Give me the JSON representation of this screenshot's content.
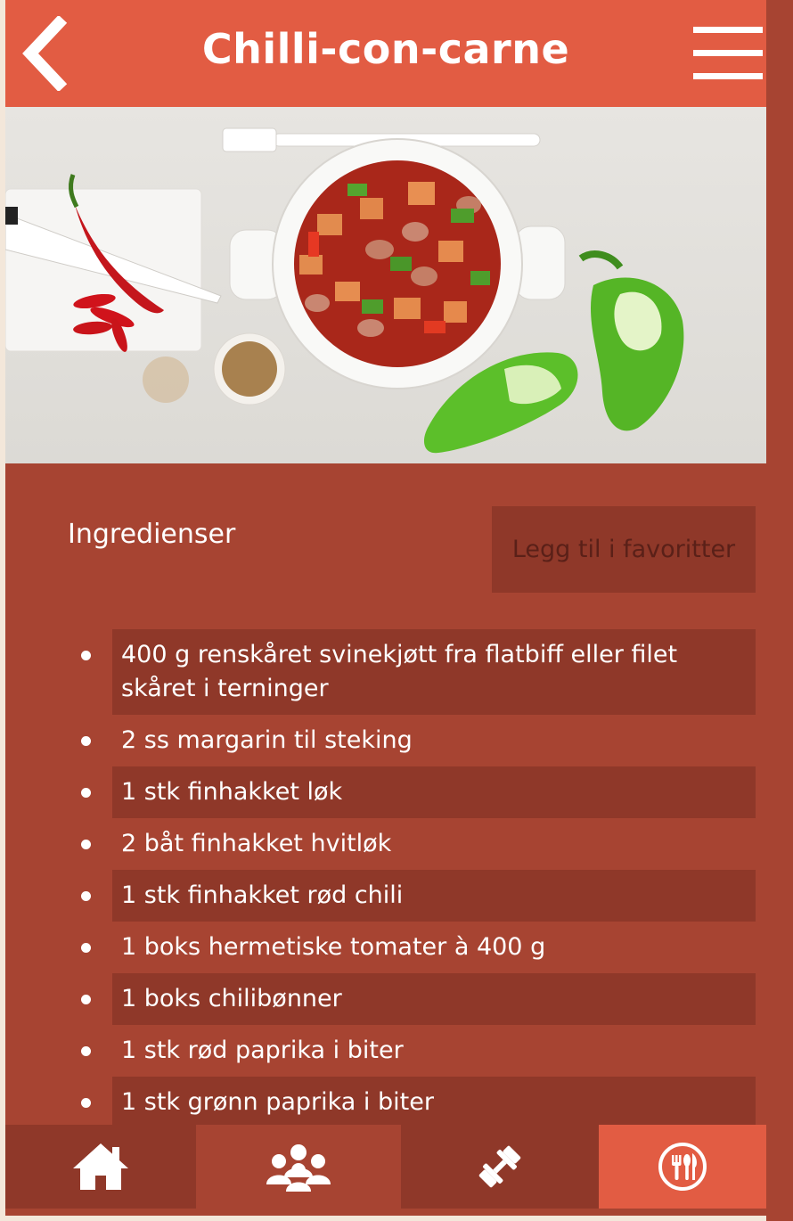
{
  "header": {
    "title": "Chilli-con-carne"
  },
  "hero": {
    "image_description": ""
  },
  "ingredients": {
    "heading": "Ingredienser",
    "favorite_button": "Legg til i favoritter",
    "items": [
      "400 g renskåret svinekjøtt fra flatbiff eller filet skåret i terninger",
      "2 ss margarin til steking",
      "1 stk finhakket løk",
      "2 båt finhakket hvitløk",
      "1 stk finhakket rød chili",
      "1 boks hermetiske tomater à 400 g",
      "1 boks chilibønner",
      "1 stk rød paprika i biter",
      "1 stk grønn paprika i biter"
    ]
  },
  "bottom_nav": {
    "items": [
      {
        "icon": "home-icon"
      },
      {
        "icon": "group-icon"
      },
      {
        "icon": "dumbbell-icon"
      },
      {
        "icon": "cutlery-icon",
        "active": true
      }
    ]
  },
  "colors": {
    "header": "#e25c43",
    "body": "#a74432",
    "row_shade": "#8f3829",
    "active_nav": "#e25c43"
  }
}
